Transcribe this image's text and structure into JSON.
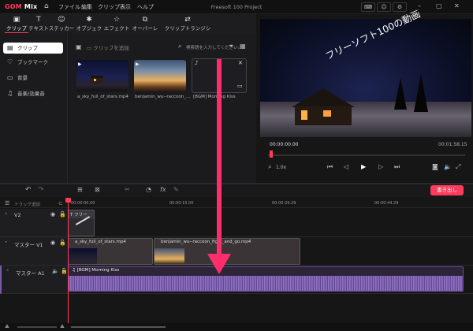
{
  "app": {
    "logo_main": "GOM",
    "logo_sub": " Mix",
    "project_title": "Freesoft 100 Project"
  },
  "menu": [
    "ファイル",
    "編集",
    "クリップ",
    "表示",
    "ヘルプ"
  ],
  "tools": [
    {
      "label": "クリップ",
      "icon": "▣"
    },
    {
      "label": "テキスト",
      "icon": "T"
    },
    {
      "label": "ステッカー",
      "icon": "☺"
    },
    {
      "label": "オブジェクト",
      "icon": "✱"
    },
    {
      "label": "エフェクト",
      "icon": "☆"
    },
    {
      "label": "オーバーレイ",
      "icon": "⧉"
    },
    {
      "label": "クリップトランジション",
      "icon": "⇄"
    }
  ],
  "sidebar": [
    {
      "label": "クリップ",
      "icon": "▤"
    },
    {
      "label": "ブックマーク",
      "icon": "♡"
    },
    {
      "label": "背景",
      "icon": "▭"
    },
    {
      "label": "音楽/効果音",
      "icon": "♫"
    }
  ],
  "media": {
    "add_clip": "クリップを追加",
    "search_placeholder": "検索語を入力してください。",
    "items": [
      "a_sky_full_of_stars.mp4",
      "benjamin_wu--raccoon_...",
      "[BGM] Morning Kiss"
    ]
  },
  "preview": {
    "overlay_text": "フリーソフト100の動画",
    "time_current": "00:00:00.00",
    "time_total": "00:01:58.15",
    "zoom": "1.0x"
  },
  "timeline": {
    "export_label": "書き出し",
    "track_add": "トラック追加",
    "ruler": [
      "00:00:00.00",
      "00:00:15.00",
      "00:00:29.29",
      "00:00:44.29"
    ],
    "tracks": [
      {
        "name": "V2"
      },
      {
        "name": "マスター V1"
      },
      {
        "name": "マスター A1"
      }
    ],
    "v2_clip": "T フリー",
    "v1_clips": [
      "a_sky_full_of_stars.mp4",
      "benjamin_wu--raccoon_fight_and_go.mp4"
    ],
    "a1_clip": "[BGM] Morning Kiss"
  },
  "colors": {
    "accent": "#ff3b5c",
    "arrow": "#ff2d6b",
    "audio": "#7a5aa6"
  }
}
